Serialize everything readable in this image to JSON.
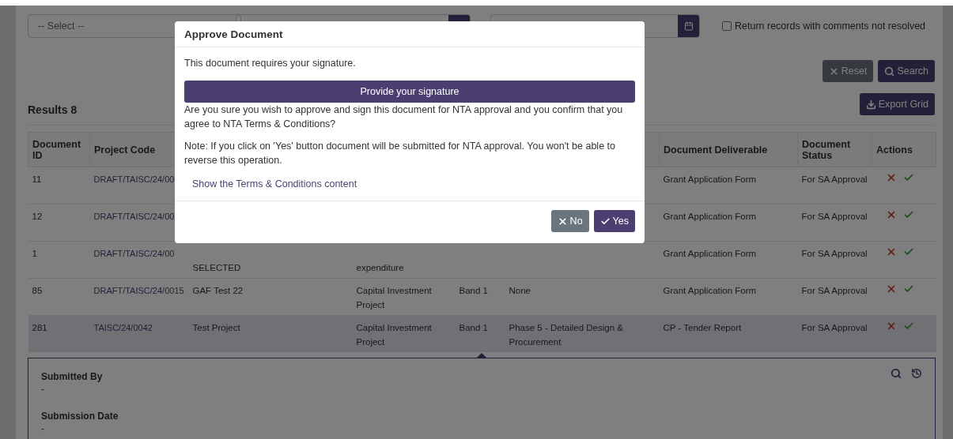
{
  "filters": {
    "deliverable": {
      "value": "-- Select --"
    },
    "comments_checkbox": {
      "label": "Return records with comments not resolved",
      "checked": false
    }
  },
  "buttons": {
    "reset": "Reset",
    "search": "Search",
    "export": "Export Grid"
  },
  "results": {
    "title": "Results 8"
  },
  "table": {
    "columns": [
      {
        "label": "Document ID"
      },
      {
        "label": "Project Code"
      },
      {},
      {},
      {},
      {},
      {
        "label": "Document Deliverable"
      },
      {
        "label": "Document Status"
      },
      {
        "label": "Actions"
      }
    ],
    "rows": [
      {
        "selected": false,
        "cells": [
          {
            "text": "11"
          },
          {
            "text": "DRAFT/TAISC/24/00",
            "kind": "link"
          },
          null,
          null,
          null,
          null,
          {
            "text": "Grant Application Form"
          },
          {
            "text": "For SA Approval"
          }
        ]
      },
      {
        "selected": false,
        "cells": [
          {
            "text": "12"
          },
          {
            "text": "DRAFT/TAISC/24/00",
            "kind": "link"
          },
          null,
          null,
          null,
          null,
          {
            "text": "Grant Application Form"
          },
          {
            "text": "For SA Approval"
          }
        ]
      },
      {
        "selected": false,
        "cells": [
          {
            "text": "1"
          },
          {
            "text": "DRAFT/TAISC/24/00",
            "kind": "link"
          },
          {
            "text": "SELECTED",
            "kind": "tail"
          },
          {
            "text": "expenditure",
            "kind": "tail"
          },
          null,
          null,
          {
            "text": "Grant Application Form"
          },
          {
            "text": "For SA Approval"
          }
        ]
      },
      {
        "selected": false,
        "cells": [
          {
            "text": "85"
          },
          {
            "text": "DRAFT/TAISC/24/0015",
            "kind": "link"
          },
          {
            "text": "GAF Test 22"
          },
          {
            "text": "Capital Investment Project"
          },
          {
            "text": "Band 1"
          },
          {
            "text": "None"
          },
          {
            "text": "Grant Application Form"
          },
          {
            "text": "For SA Approval"
          }
        ]
      },
      {
        "selected": true,
        "cells": [
          {
            "text": "281"
          },
          {
            "text": "TAISC/24/0042",
            "kind": "link"
          },
          {
            "text": "Test Project"
          },
          {
            "text": "Capital Investment Project"
          },
          {
            "text": "Band 1"
          },
          {
            "text": "Phase 5 - Detailed Design & Procurement"
          },
          {
            "text": "CP - Tender Report"
          },
          {
            "text": "For SA Approval"
          }
        ]
      }
    ]
  },
  "detail": {
    "expanded": true,
    "fields": [
      {
        "label": "Submitted By",
        "value": "-"
      },
      {
        "label": "Submission Date",
        "value": "-"
      }
    ]
  },
  "dialog": {
    "title": "Approve Document",
    "intro": "This document requires your signature.",
    "sign_button": "Provide your signature",
    "question": "Are you sure you wish to approve and sign this document for NTA approval and you confirm that you agree to NTA Terms & Conditions?",
    "note": "Note: If you click on 'Yes' button document will be submitted for NTA approval. You won't be able to reverse this operation.",
    "terms_link": "Show the Terms & Conditions content",
    "no_button": "No",
    "yes_button": "Yes"
  }
}
